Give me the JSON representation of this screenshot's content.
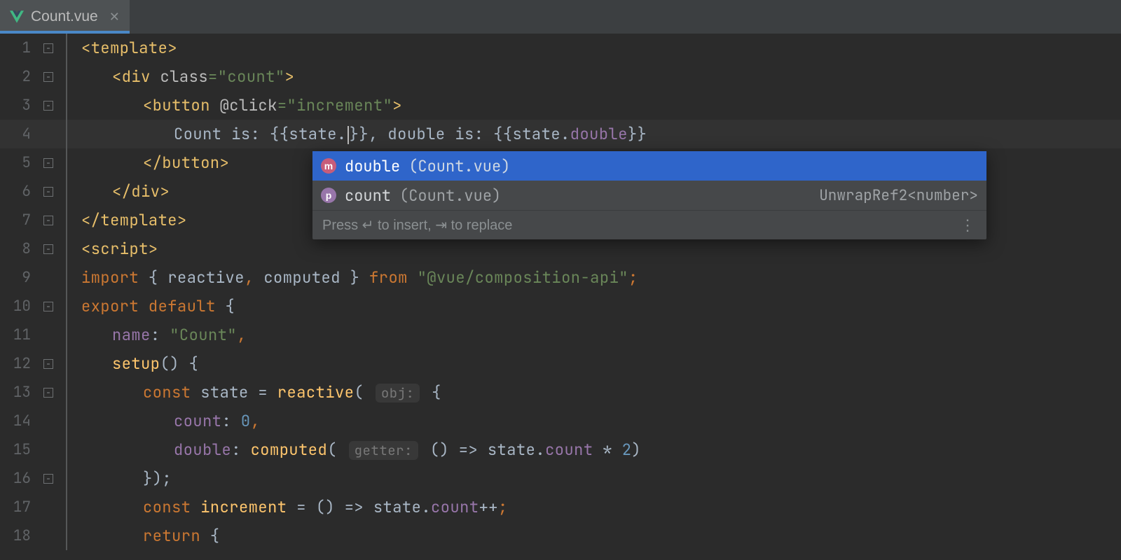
{
  "tab": {
    "filename": "Count.vue"
  },
  "gutter": {
    "lines": [
      "1",
      "2",
      "3",
      "4",
      "5",
      "6",
      "7",
      "8",
      "9",
      "10",
      "11",
      "12",
      "13",
      "14",
      "15",
      "16",
      "17",
      "18"
    ]
  },
  "code": {
    "l1": {
      "open": "<",
      "tag": "template",
      "close": ">"
    },
    "l2": {
      "open": "<",
      "tag": "div",
      "sp": " ",
      "attr": "class",
      "eq": "=",
      "qv": "\"count\"",
      "close": ">"
    },
    "l3": {
      "open": "<",
      "tag": "button",
      "sp": " ",
      "attr": "@click",
      "eq": "=",
      "qv": "\"increment\"",
      "close": ">"
    },
    "l4": {
      "t1": "Count is: {{",
      "p1": "state",
      "dot": ".",
      "t2": "}}, double is: {{",
      "p2": "state",
      "dot2": ".",
      "p3": "double",
      "t3": "}}"
    },
    "l5": {
      "open": "</",
      "tag": "button",
      "close": ">"
    },
    "l6": {
      "open": "</",
      "tag": "div",
      "close": ">"
    },
    "l7": {
      "open": "</",
      "tag": "template",
      "close": ">"
    },
    "l8": {
      "open": "<",
      "tag": "script",
      "close": ">"
    },
    "l9": {
      "kw": "import ",
      "b1": "{ ",
      "i1": "reactive",
      "c": ", ",
      "i2": "computed",
      "b2": " } ",
      "from": "from ",
      "s": "\"@vue/composition-api\"",
      "semi": ";"
    },
    "l10": {
      "kw": "export default ",
      "b": "{"
    },
    "l11": {
      "prop": "name",
      "colon": ": ",
      "s": "\"Count\"",
      "comma": ","
    },
    "l12": {
      "fn": "setup",
      "paren": "() {"
    },
    "l13": {
      "kw": "const ",
      "id": "state ",
      "eq": "= ",
      "fn": "reactive",
      "open": "( ",
      "hint": "obj:",
      "sp": " ",
      "brace": "{"
    },
    "l14": {
      "prop": "count",
      "colon": ": ",
      "num": "0",
      "comma": ","
    },
    "l15": {
      "prop": "double",
      "colon": ": ",
      "fn": "computed",
      "open": "( ",
      "hint": "getter:",
      "sp": " ",
      "arrow": "() => ",
      "id": "state",
      "dot": ".",
      "p": "count",
      "op": " * ",
      "num": "2",
      "close": ")"
    },
    "l16": {
      "close": "});"
    },
    "l17": {
      "kw": "const ",
      "fn": "increment ",
      "eq": "= () => ",
      "id": "state",
      "dot": ".",
      "p": "count",
      "op": "++",
      "semi": ";"
    },
    "l18": {
      "kw": "return ",
      "b": "{"
    }
  },
  "completion": {
    "items": [
      {
        "badge": "m",
        "label": "double",
        "loc": "(Count.vue)",
        "type": ""
      },
      {
        "badge": "p",
        "label": "count",
        "loc": "(Count.vue)",
        "type": "UnwrapRef2<number>"
      }
    ],
    "footer": "Press ↵ to insert, ⇥ to replace"
  }
}
